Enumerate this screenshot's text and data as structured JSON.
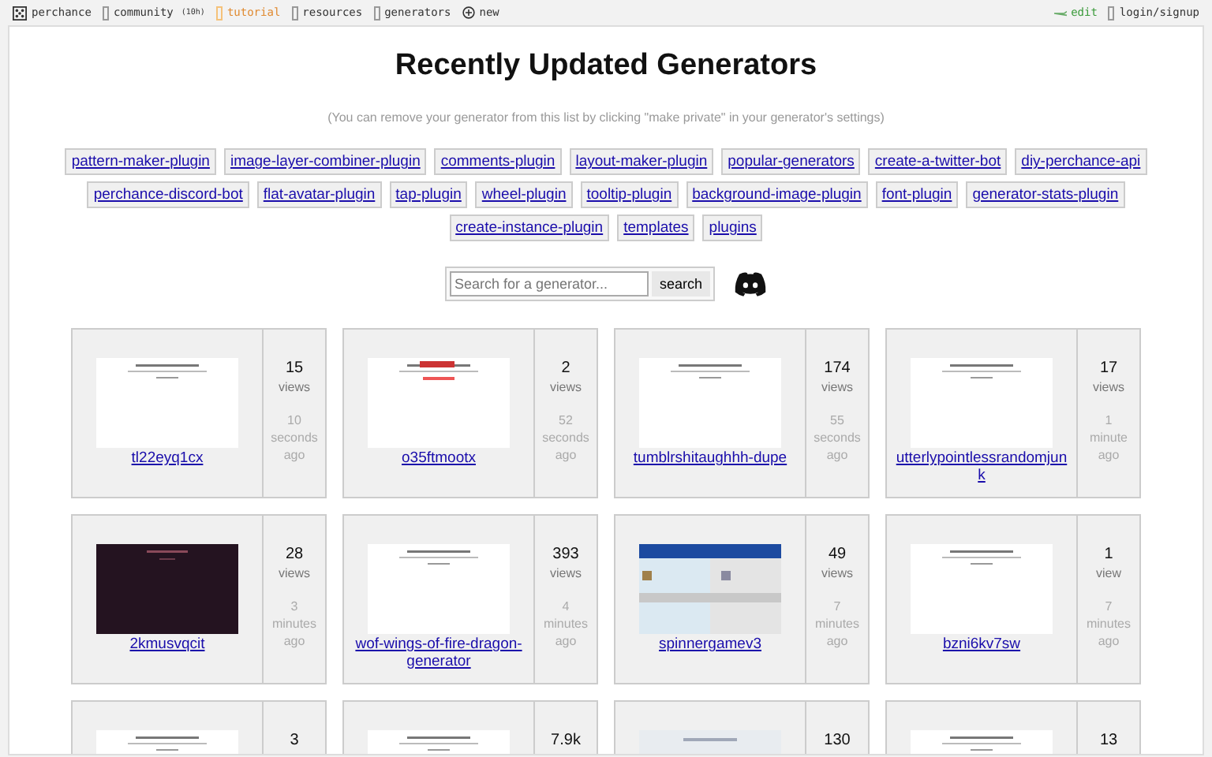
{
  "nav": {
    "left": [
      {
        "label": "perchance",
        "kind": "logo"
      },
      {
        "label": "community",
        "note": "(10h)",
        "kind": "link"
      },
      {
        "label": "tutorial",
        "kind": "highlight"
      },
      {
        "label": "resources",
        "kind": "link"
      },
      {
        "label": "generators",
        "kind": "link"
      },
      {
        "label": "new",
        "kind": "new"
      }
    ],
    "right": [
      {
        "label": "edit",
        "kind": "edit"
      },
      {
        "label": "login/signup",
        "kind": "link"
      }
    ]
  },
  "title": "Recently Updated Generators",
  "subtitle": "(You can remove your generator from this list by clicking \"make private\" in your generator's settings)",
  "tags": [
    "pattern-maker-plugin",
    "image-layer-combiner-plugin",
    "comments-plugin",
    "layout-maker-plugin",
    "popular-generators",
    "create-a-twitter-bot",
    "diy-perchance-api",
    "perchance-discord-bot",
    "flat-avatar-plugin",
    "tap-plugin",
    "wheel-plugin",
    "tooltip-plugin",
    "background-image-plugin",
    "font-plugin",
    "generator-stats-plugin",
    "create-instance-plugin",
    "templates",
    "plugins"
  ],
  "search": {
    "placeholder": "Search for a generator...",
    "button": "search"
  },
  "generators": [
    {
      "name": "tl22eyq1cx",
      "views": "15",
      "views_label": "views",
      "time": "10",
      "unit": "seconds",
      "ago": "ago"
    },
    {
      "name": "o35ftmootx",
      "views": "2",
      "views_label": "views",
      "time": "52",
      "unit": "seconds",
      "ago": "ago"
    },
    {
      "name": "tumblrshitaughhh-dupe",
      "views": "174",
      "views_label": "views",
      "time": "55",
      "unit": "seconds",
      "ago": "ago"
    },
    {
      "name": "utterlypointlessrandomjunk",
      "views": "17",
      "views_label": "views",
      "time": "1",
      "unit": "minute",
      "ago": "ago"
    },
    {
      "name": "2kmusvqcit",
      "views": "28",
      "views_label": "views",
      "time": "3",
      "unit": "minutes",
      "ago": "ago"
    },
    {
      "name": "wof-wings-of-fire-dragon-generator",
      "views": "393",
      "views_label": "views",
      "time": "4",
      "unit": "minutes",
      "ago": "ago"
    },
    {
      "name": "spinnergamev3",
      "views": "49",
      "views_label": "views",
      "time": "7",
      "unit": "minutes",
      "ago": "ago"
    },
    {
      "name": "bzni6kv7sw",
      "views": "1",
      "views_label": "view",
      "time": "7",
      "unit": "minutes",
      "ago": "ago"
    },
    {
      "views": "3"
    },
    {
      "views": "7.9k"
    },
    {
      "views": "130"
    },
    {
      "views": "13"
    }
  ]
}
